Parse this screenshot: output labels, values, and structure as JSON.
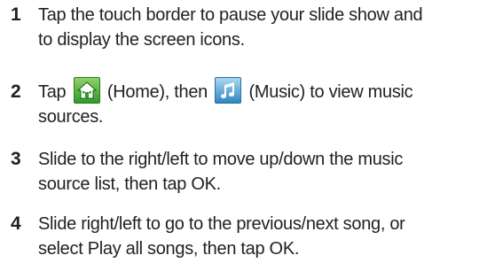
{
  "steps": [
    {
      "number": "1",
      "line1": "Tap the touch border to pause your slide show and",
      "line2": "to display the screen icons."
    },
    {
      "number": "2",
      "tap": "Tap",
      "home_label": "(Home), then",
      "music_label": "(Music) to view music",
      "line2": "sources.",
      "home_icon": "home-icon",
      "music_icon": "music-note-icon"
    },
    {
      "number": "3",
      "line1": "Slide to the right/left to move up/down the music",
      "line2": "source list, then tap OK."
    },
    {
      "number": "4",
      "line1": "Slide right/left to go to the previous/next song, or",
      "line2": "select Play all songs, then tap OK."
    }
  ],
  "colors": {
    "text": "#231f20",
    "home_button": "#3aa32f",
    "music_button": "#3a8fc8"
  }
}
